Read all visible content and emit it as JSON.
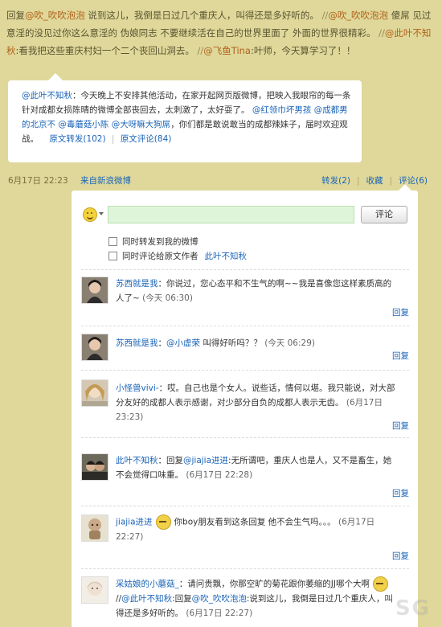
{
  "repost": {
    "parts": [
      {
        "t": "回复",
        "c": "txt"
      },
      {
        "t": "@吹_吹吹泡泡",
        "c": "at"
      },
      {
        "t": " 说到这儿，我倒是日过几个重庆人，叫得还是多好听的。 ",
        "c": "txt"
      },
      {
        "t": "//",
        "c": "sep"
      },
      {
        "t": "@吹_吹吹泡泡",
        "c": "at"
      },
      {
        "t": " 傻屌 见过意淫的没见过你这么意淫的 伪娘同志 不要继续活在自己的世界里面了 外面的世界很精彩。 ",
        "c": "txt"
      },
      {
        "t": "//",
        "c": "sep"
      },
      {
        "t": "@此叶不知秋",
        "c": "at"
      },
      {
        "t": ":看我把这些重庆村妇一个二个丧回山洞去。 ",
        "c": "txt"
      },
      {
        "t": "//",
        "c": "sep"
      },
      {
        "t": "@飞鱼Tina",
        "c": "at"
      },
      {
        "t": ":叶师，今天算学习了！！",
        "c": "txt"
      }
    ]
  },
  "quote": {
    "author": "@此叶不知秋",
    "text1": "：今天晚上不安排其他活动，在家开起网页版微博，把映入我眼帘的每一条针对成都女损陈晴的微博全部丧回去，太刺激了，太好耍了。",
    "mentions": [
      "@红领巾坏男孩",
      "@成都男的北京不",
      "@毒蘑菇小陈",
      "@大呀嘛大狗屌"
    ],
    "text2": "，你们都是敢说敢当的成都辣妹子，届时欢迎观战。",
    "repost_link": "原文转发(102)",
    "comment_link": "原文评论(84)"
  },
  "meta": {
    "date": "6月17日 22:23",
    "source": "来自新浪微博",
    "forward": "转发(2)",
    "favorite": "收藏",
    "comment": "评论(6)"
  },
  "composer": {
    "input_value": "",
    "button": "评论",
    "opt1": "同时转发到我的微博",
    "opt2_label": "同时评论给原文作者",
    "opt2_user": "此叶不知秋"
  },
  "comments": [
    {
      "name": "苏西就是我",
      "text": "你说过，您心态平和不生气的啊~~我是喜像您这样素质高的人了~",
      "time": "(今天 06:30)",
      "reply": "回复"
    },
    {
      "name": "苏西就是我",
      "mention": "@小虚荣",
      "text": "叫得好听吗？？",
      "time": "(今天 06:29)",
      "reply": "回复"
    },
    {
      "name": "小怪兽vivi-",
      "text": "哎。自己也是个女人。说些话，情何以堪。我只能说，对大部分友好的成都人表示感谢，对少部分自负的成都人表示无齿。",
      "time": "(6月17日 23:23)",
      "reply": "回复"
    },
    {
      "name": "此叶不知秋",
      "pre": "回复",
      "mention": "@jiajia进进",
      "text": ":无所谓吧，重庆人也是人，又不是畜生，她不会觉得口味重。",
      "time": "(6月17日 22:28)",
      "reply": "回复"
    },
    {
      "name": "jiajia进进",
      "text": "你boy朋友看到这条回复 他不会生气吗。。。",
      "time": "(6月17日 22:27)",
      "reply": "回复"
    },
    {
      "name": "采姑娘的小蘑菇_",
      "text": "请问贵飘，你那空旷的菊花跟你萎缩的JJ哪个大啊",
      "line2_sep": "//",
      "line2_mention": "@此叶不知秋",
      "line2_pre": ":回复",
      "line2_mention2": "@吹_吹吹泡泡",
      "line2_text": ":说到这儿，我倒是日过几个重庆人，叫得还是多好听的。",
      "time": "(6月17日 22:27)"
    }
  ],
  "watermark": "SG"
}
